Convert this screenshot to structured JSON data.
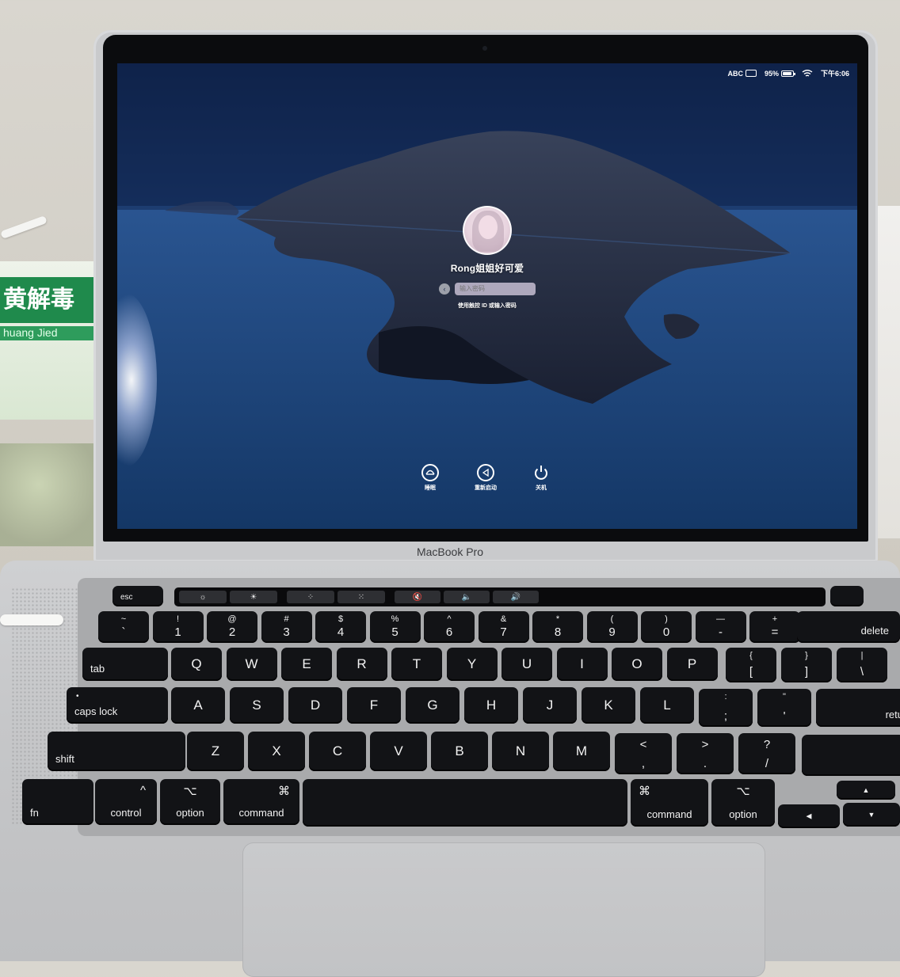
{
  "background": {
    "box_banner_text": "黄解毒",
    "box_sub_text": "huang Jied"
  },
  "menubar": {
    "input_source": "ABC",
    "battery_percent": "95%",
    "battery_level": 0.95,
    "time": "下午6:06"
  },
  "login": {
    "username": "Rong姐姐好可爱",
    "password_placeholder": "输入密码",
    "hint": "使用触控 ID 或输入密码"
  },
  "actions": [
    {
      "label": "睡眠",
      "icon": "sleep-icon"
    },
    {
      "label": "重新启动",
      "icon": "restart-icon"
    },
    {
      "label": "关机",
      "icon": "power-icon"
    }
  ],
  "device_label": "MacBook Pro",
  "touchbar": {
    "esc": "esc",
    "buttons": [
      "☼",
      "☀",
      "⁘",
      "⁙",
      "🔇",
      "🔈",
      "🔊"
    ]
  },
  "keyboard": {
    "row1": [
      {
        "top": "~",
        "bot": "`"
      },
      {
        "top": "!",
        "bot": "1"
      },
      {
        "top": "@",
        "bot": "2"
      },
      {
        "top": "#",
        "bot": "3"
      },
      {
        "top": "$",
        "bot": "4"
      },
      {
        "top": "%",
        "bot": "5"
      },
      {
        "top": "^",
        "bot": "6"
      },
      {
        "top": "&",
        "bot": "7"
      },
      {
        "top": "*",
        "bot": "8"
      },
      {
        "top": "(",
        "bot": "9"
      },
      {
        "top": ")",
        "bot": "0"
      },
      {
        "top": "—",
        "bot": "-"
      },
      {
        "top": "+",
        "bot": "="
      }
    ],
    "delete": "delete",
    "tab": "tab",
    "row2": [
      "Q",
      "W",
      "E",
      "R",
      "T",
      "Y",
      "U",
      "I",
      "O",
      "P"
    ],
    "row2_brackets": [
      {
        "top": "{",
        "bot": "["
      },
      {
        "top": "}",
        "bot": "]"
      },
      {
        "top": "|",
        "bot": "\\"
      }
    ],
    "caps": "caps lock",
    "row3": [
      "A",
      "S",
      "D",
      "F",
      "G",
      "H",
      "J",
      "K",
      "L"
    ],
    "row3_punct": [
      {
        "top": ":",
        "bot": ";"
      },
      {
        "top": "\"",
        "bot": "'"
      }
    ],
    "return": "retu",
    "shift": "shift",
    "row4": [
      "Z",
      "X",
      "C",
      "V",
      "B",
      "N",
      "M"
    ],
    "row4_punct": [
      {
        "top": "<",
        "bot": ","
      },
      {
        "top": ">",
        "bot": "."
      },
      {
        "top": "?",
        "bot": "/"
      }
    ],
    "fn": "fn",
    "control": {
      "sym": "^",
      "word": "control"
    },
    "option_l": {
      "sym": "⌥",
      "word": "option"
    },
    "command_l": {
      "sym": "⌘",
      "word": "command"
    },
    "command_r": {
      "sym": "⌘",
      "word": "command"
    },
    "option_r": {
      "sym": "⌥",
      "word": "option"
    },
    "arrows": {
      "up": "▲",
      "left": "◀",
      "down": "▼"
    }
  }
}
